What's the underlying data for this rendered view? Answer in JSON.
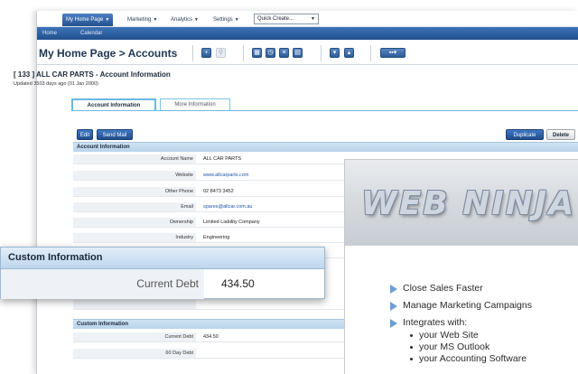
{
  "topnav": {
    "items": [
      {
        "label": "My Home Page",
        "active": true
      },
      {
        "label": "Marketing",
        "active": false
      },
      {
        "label": "Analytics",
        "active": false
      },
      {
        "label": "Settings",
        "active": false
      }
    ],
    "quick_create": "Quick Create..."
  },
  "subnav": {
    "items": [
      "Home",
      "Calendar"
    ]
  },
  "page": {
    "title": "My Home Page > Accounts",
    "account_line": "[ 133 ] ALL CAR PARTS - Account Information",
    "updated": "Updated 3503 days ago (01 Jan 2000)"
  },
  "tabs": [
    {
      "label": "Account Information",
      "active": true
    },
    {
      "label": "More Information",
      "active": false
    }
  ],
  "buttons": {
    "edit": "Edit",
    "send_mail": "Send Mail",
    "duplicate": "Duplicate",
    "delete": "Delete"
  },
  "account_section": {
    "title": "Account Information",
    "rows": [
      {
        "label": "Account Name",
        "value": "ALL CAR PARTS"
      },
      {
        "label": "Website",
        "value": "www.allcarparts.com"
      },
      {
        "label": "Other Phone",
        "value": "02 8473 3452"
      },
      {
        "label": "Email",
        "value": "spares@allcar.com.au"
      },
      {
        "label": "Ownership",
        "value": "Limited Liability Company"
      },
      {
        "label": "Industry",
        "value": "Engineering"
      }
    ]
  },
  "custom_section": {
    "title": "Custom Information",
    "rows": [
      {
        "label": "Current Debt",
        "value": "434.50"
      },
      {
        "label": "60 Day Debt",
        "value": ""
      }
    ]
  },
  "callout": {
    "title": "Custom Information",
    "label": "Current Debt",
    "value": "434.50"
  },
  "ad": {
    "logo": "WEB NINJA",
    "bullets": [
      "Close Sales Faster",
      "Manage Marketing Campaigns",
      "Integrates with:"
    ],
    "sub_bullets": [
      "your Web Site",
      "your MS Outlook",
      "your Accounting Software"
    ]
  },
  "colors": {
    "accent": "#2d5c98",
    "nav_blue": "#3d73b8",
    "section_blue": "#b9d3eb",
    "tab_border": "#6ab9e0"
  }
}
